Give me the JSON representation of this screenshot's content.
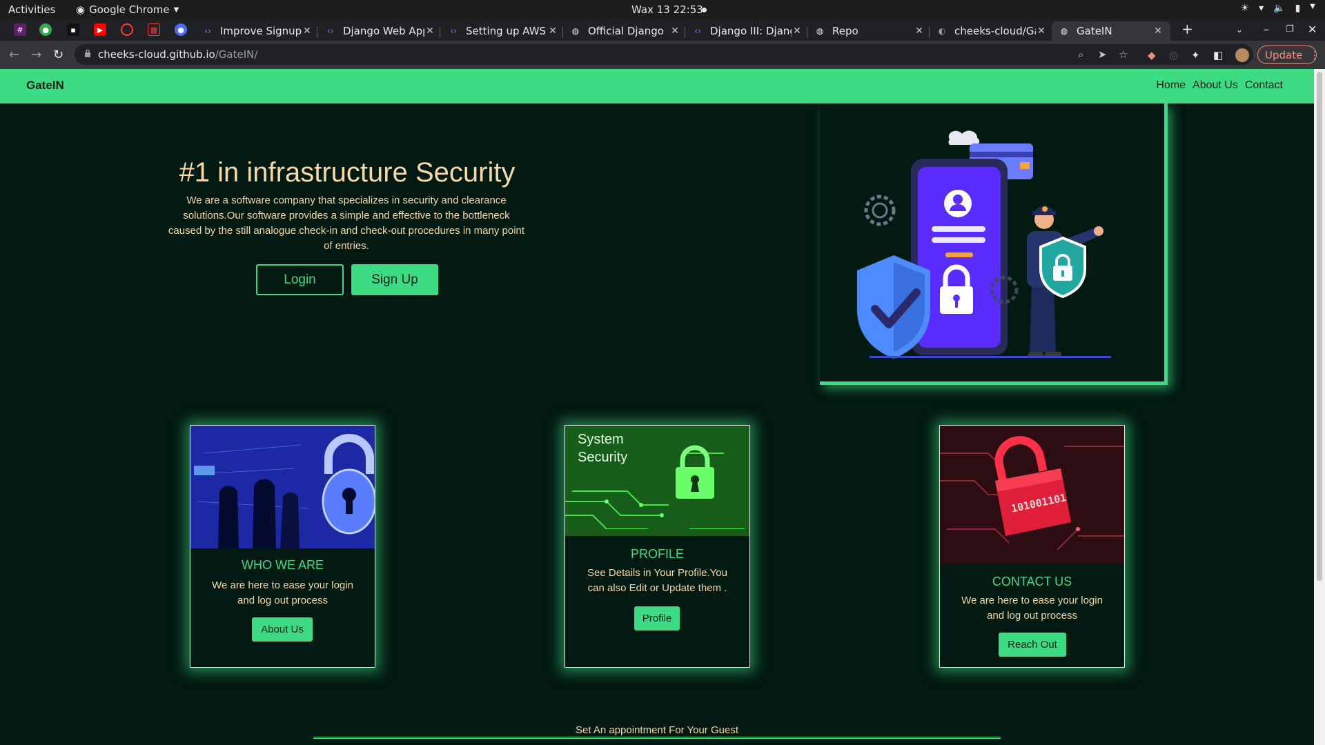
{
  "system": {
    "activities": "Activities",
    "app_name": "Google Chrome",
    "clock": "Wax 13  22:53"
  },
  "tabs": [
    {
      "title": "Improve Signup",
      "favicon": "code-icon"
    },
    {
      "title": "Django Web App",
      "favicon": "code-icon"
    },
    {
      "title": "Setting up AWS",
      "favicon": "code-icon"
    },
    {
      "title": "Official Django",
      "favicon": "globe-icon"
    },
    {
      "title": "Django III: Djang",
      "favicon": "code-icon"
    },
    {
      "title": "Repo",
      "favicon": "globe-icon"
    },
    {
      "title": "cheeks-cloud/Ga",
      "favicon": "github-icon"
    },
    {
      "title": "GateIN",
      "favicon": "globe-icon",
      "active": true
    }
  ],
  "browser": {
    "url_host": "cheeks-cloud.github.io",
    "url_path": "/GateIN/",
    "update_label": "Update"
  },
  "site": {
    "brand": "GateIN",
    "nav": [
      "Home",
      "About Us",
      "Contact"
    ],
    "hero": {
      "title": "#1 in infrastructure Security",
      "description": "We are a software company that specializes in security and clearance solutions.Our software provides a simple and effective to the bottleneck caused by the still analogue check-in and check-out procedures in many point of entries.",
      "login_label": "Login",
      "signup_label": "Sign Up"
    },
    "cards": [
      {
        "title": "WHO WE ARE",
        "text": "We are here to ease your login and log out process",
        "button": "About Us"
      },
      {
        "title": "PROFILE",
        "text": "See Details in Your Profile.You can also Edit or Update them .",
        "button": "Profile",
        "image_text": "System\nSecurity"
      },
      {
        "title": "CONTACT US",
        "text": "We are here to ease your login and log out process",
        "button": "Reach Out",
        "image_text": "101001101"
      }
    ],
    "appointment": "Set An appointment For Your Guest"
  },
  "colors": {
    "accent": "#3ddc84",
    "background": "#031a12",
    "text": "#f7d9a8"
  }
}
